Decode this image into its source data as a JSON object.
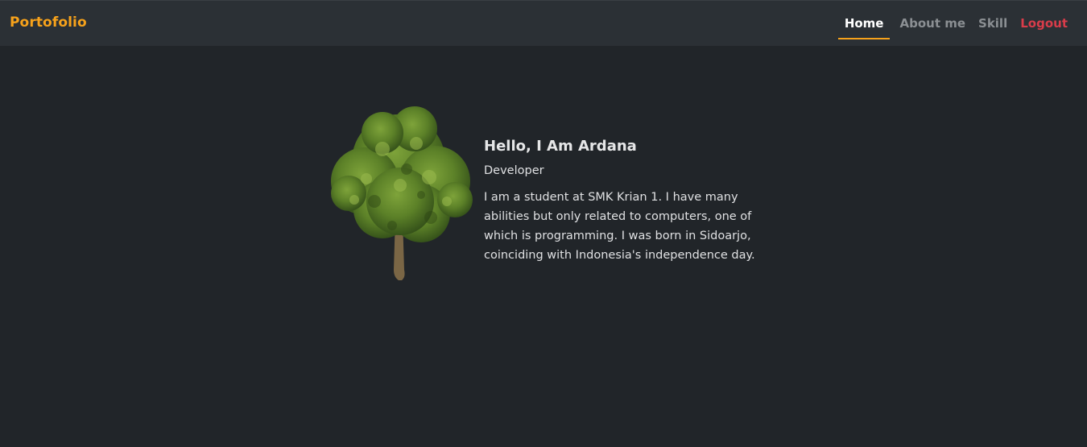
{
  "navbar": {
    "brand": "Portofolio",
    "links": [
      {
        "label": "Home",
        "active": true
      },
      {
        "label": "About me",
        "active": false
      },
      {
        "label": "Skill",
        "active": false
      },
      {
        "label": "Logout",
        "active": false
      }
    ]
  },
  "hero": {
    "image_icon": "tree-image",
    "title": "Hello, I Am Ardana",
    "role": "Developer",
    "bio": "I am a student at SMK Krian 1. I have many abilities but only related to computers, one of which is programming. I was born in Sidoarjo, coinciding with Indonesia's independence day."
  },
  "colors": {
    "background": "#212529",
    "navbar": "#2b3035",
    "brand": "#f7a21b",
    "nav_inactive": "#8b8f93",
    "nav_active": "#ffffff",
    "logout": "#d93c4a",
    "text": "#dfe0e2"
  }
}
